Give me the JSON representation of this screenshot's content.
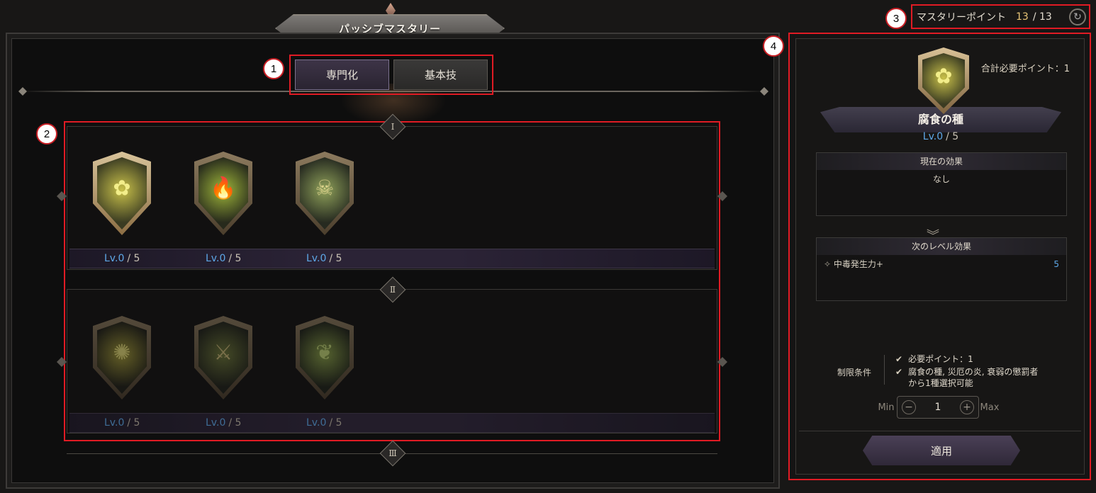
{
  "header": {
    "title": "パッシブマスタリー"
  },
  "tabs": [
    {
      "label": "専門化",
      "active": true
    },
    {
      "label": "基本技",
      "active": false
    }
  ],
  "callouts": [
    "1",
    "2",
    "3",
    "4"
  ],
  "tiers": [
    "Ⅰ",
    "Ⅱ",
    "Ⅲ"
  ],
  "tier1": {
    "skills": [
      {
        "icon": "corrosion-seed-icon",
        "glyph": "✿",
        "level": "Lv.0",
        "max": "/ 5"
      },
      {
        "icon": "disaster-flame-icon",
        "glyph": "🔥",
        "level": "Lv.0",
        "max": "/ 5"
      },
      {
        "icon": "weakness-punisher-icon",
        "glyph": "☠",
        "level": "Lv.0",
        "max": "/ 5"
      }
    ]
  },
  "tier2": {
    "skills": [
      {
        "icon": "radiant-figure-icon",
        "glyph": "✺",
        "level": "Lv.0",
        "max": "/ 5"
      },
      {
        "icon": "thorn-spear-icon",
        "glyph": "⚔",
        "level": "Lv.0",
        "max": "/ 5"
      },
      {
        "icon": "green-flame-icon",
        "glyph": "❦",
        "level": "Lv.0",
        "max": "/ 5"
      }
    ]
  },
  "points": {
    "label": "マスタリーポイント",
    "current": "13",
    "total": "/ 13"
  },
  "detail": {
    "total_required": "合計必要ポイント：1",
    "skill_name": "腐食の種",
    "level": "Lv.0",
    "max": "/ 5",
    "current_effect_head": "現在の効果",
    "current_effect": "なし",
    "next_effect_head": "次のレベル効果",
    "next_effect_name": "中毒発生力+",
    "next_effect_value": "5",
    "condition_label": "制限条件",
    "conditions": [
      "必要ポイント：1",
      "腐食の種, 災厄の炎, 衰弱の懲罰者",
      "から1種選択可能"
    ],
    "stepper": {
      "min": "Min",
      "max": "Max",
      "value": "1"
    },
    "apply": "適用"
  },
  "colors": {
    "accent_red": "#e01b24",
    "level_blue": "#5ea8e8",
    "gold": "#e8c577"
  }
}
